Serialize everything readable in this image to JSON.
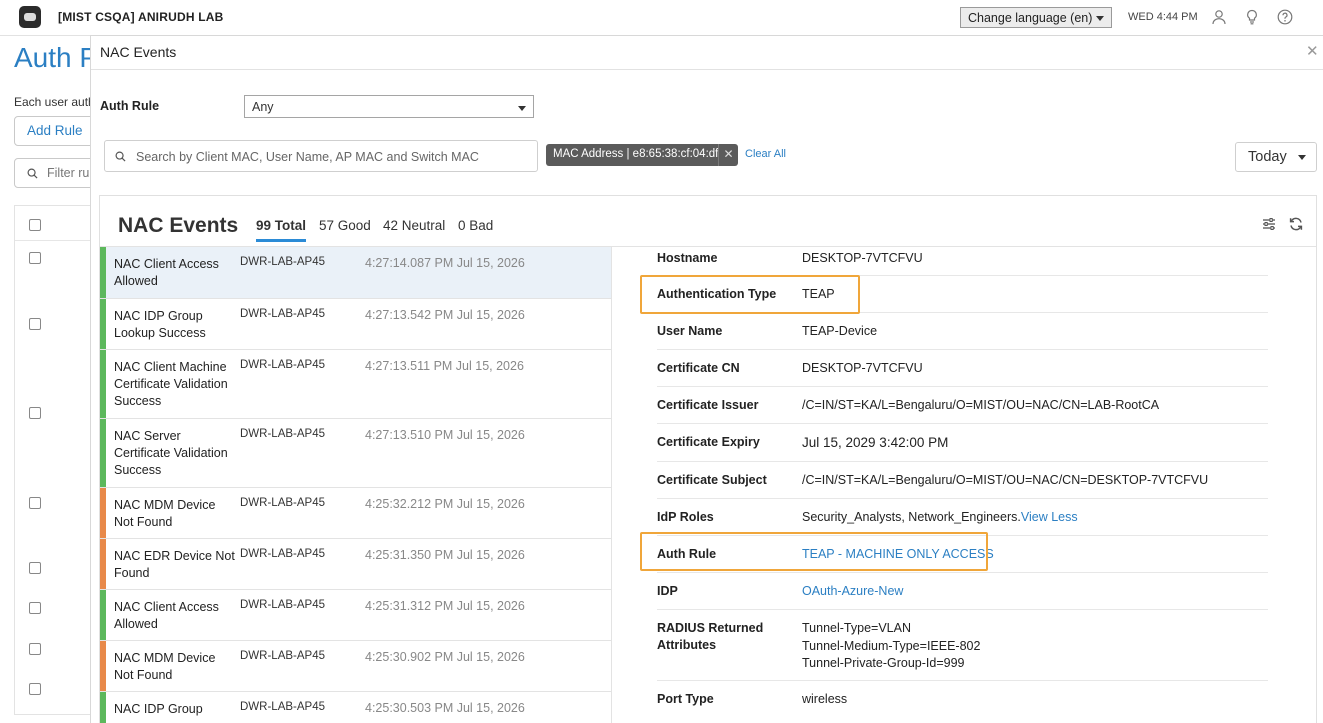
{
  "topbar": {
    "org": "[MIST CSQA] ANIRUDH LAB",
    "language": "Change language (en)",
    "clock": "WED 4:44 PM"
  },
  "background_page": {
    "title": "Auth P",
    "description": "Each user auth",
    "add_rule": "Add Rule",
    "filter_placeholder": "Filter rul"
  },
  "modal": {
    "title": "NAC Events",
    "auth_rule_label": "Auth Rule",
    "auth_rule_value": "Any",
    "search_placeholder": "Search by Client MAC, User Name, AP MAC and Switch MAC",
    "filter_chip": "MAC Address | e8:65:38:cf:04:df",
    "clear_all": "Clear All",
    "time_range": "Today"
  },
  "events": {
    "title": "NAC Events",
    "tabs": [
      {
        "label": "99 Total",
        "active": true
      },
      {
        "label": "57 Good",
        "active": false
      },
      {
        "label": "42 Neutral",
        "active": false
      },
      {
        "label": "0 Bad",
        "active": false
      }
    ],
    "status_colors": {
      "good": "#5cb85c",
      "neutral": "#e8894a"
    },
    "items": [
      {
        "name": "NAC Client Access Allowed",
        "ap": "DWR-LAB-AP45",
        "time": "4:27:14.087 PM Jul 15, 2026",
        "status": "good"
      },
      {
        "name": "NAC IDP Group Lookup Success",
        "ap": "DWR-LAB-AP45",
        "time": "4:27:13.542 PM Jul 15, 2026",
        "status": "good"
      },
      {
        "name": "NAC Client Machine Certificate Validation Success",
        "ap": "DWR-LAB-AP45",
        "time": "4:27:13.511 PM Jul 15, 2026",
        "status": "good"
      },
      {
        "name": "NAC Server Certificate Validation Success",
        "ap": "DWR-LAB-AP45",
        "time": "4:27:13.510 PM Jul 15, 2026",
        "status": "good"
      },
      {
        "name": "NAC MDM Device Not Found",
        "ap": "DWR-LAB-AP45",
        "time": "4:25:32.212 PM Jul 15, 2026",
        "status": "neutral"
      },
      {
        "name": "NAC EDR Device Not Found",
        "ap": "DWR-LAB-AP45",
        "time": "4:25:31.350 PM Jul 15, 2026",
        "status": "neutral"
      },
      {
        "name": "NAC Client Access Allowed",
        "ap": "DWR-LAB-AP45",
        "time": "4:25:31.312 PM Jul 15, 2026",
        "status": "good"
      },
      {
        "name": "NAC MDM Device Not Found",
        "ap": "DWR-LAB-AP45",
        "time": "4:25:30.902 PM Jul 15, 2026",
        "status": "neutral"
      },
      {
        "name": "NAC IDP Group",
        "ap": "DWR-LAB-AP45",
        "time": "4:25:30.503 PM Jul 15, 2026",
        "status": "good"
      }
    ]
  },
  "details": {
    "hostname": {
      "label": "Hostname",
      "value": "DESKTOP-7VTCFVU"
    },
    "auth_type": {
      "label": "Authentication Type",
      "value": "TEAP"
    },
    "user_name": {
      "label": "User Name",
      "value": "TEAP-Device"
    },
    "cert_cn": {
      "label": "Certificate CN",
      "value": "DESKTOP-7VTCFVU"
    },
    "cert_issuer": {
      "label": "Certificate Issuer",
      "value": "/C=IN/ST=KA/L=Bengaluru/O=MIST/OU=NAC/CN=LAB-RootCA"
    },
    "cert_expiry": {
      "label": "Certificate Expiry",
      "value": "Jul 15, 2029 3:42:00 PM"
    },
    "cert_subject": {
      "label": "Certificate Subject",
      "value": "/C=IN/ST=KA/L=Bengaluru/O=MIST/OU=NAC/CN=DESKTOP-7VTCFVU"
    },
    "idp_roles": {
      "label": "IdP Roles",
      "value": "Security_Analysts, Network_Engineers.",
      "link": "View Less"
    },
    "auth_rule": {
      "label": "Auth Rule",
      "value": "TEAP - MACHINE ONLY ACCESS"
    },
    "idp": {
      "label": "IDP",
      "value": "OAuth-Azure-New"
    },
    "radius": {
      "label_line1": "RADIUS Returned",
      "label_line2": "Attributes",
      "values": [
        "Tunnel-Type=VLAN",
        "Tunnel-Medium-Type=IEEE-802",
        "Tunnel-Private-Group-Id=999"
      ]
    },
    "port_type": {
      "label": "Port Type",
      "value": "wireless"
    },
    "highlight_color": "#f0a63a"
  }
}
